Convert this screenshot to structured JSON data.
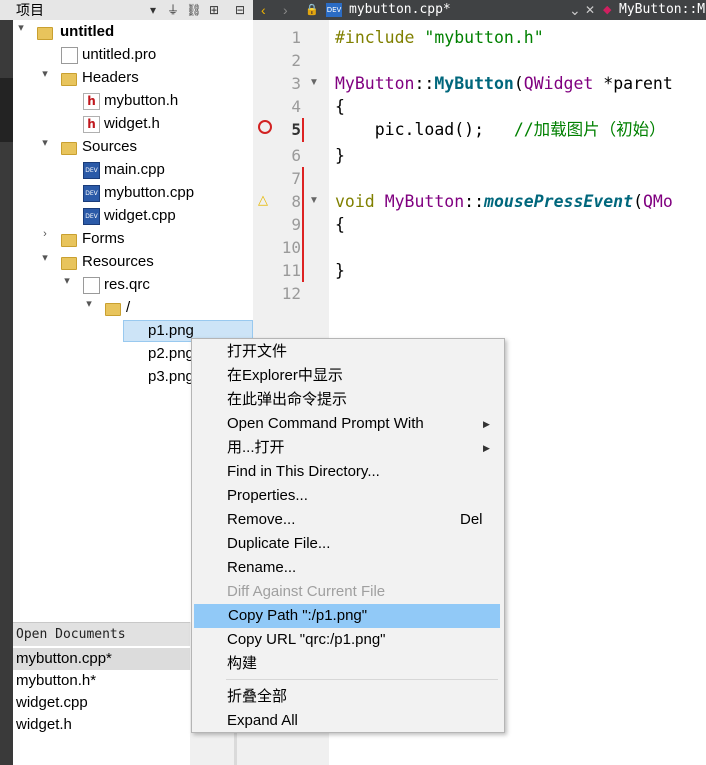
{
  "project_panel": {
    "title": "项目",
    "tree": {
      "project": "untitled",
      "pro_file": "untitled.pro",
      "headers_label": "Headers",
      "headers": [
        "mybutton.h",
        "widget.h"
      ],
      "sources_label": "Sources",
      "sources": [
        "main.cpp",
        "mybutton.cpp",
        "widget.cpp"
      ],
      "forms_label": "Forms",
      "resources_label": "Resources",
      "qrc_file": "res.qrc",
      "prefix": "/",
      "images": [
        "p1.png",
        "p2.png",
        "p3.png"
      ]
    }
  },
  "editor": {
    "file_tab": "mybutton.cpp*",
    "symbol": "MyButton::M",
    "badge": "DEV",
    "line_numbers": [
      "1",
      "2",
      "3",
      "4",
      "5",
      "6",
      "7",
      "8",
      "9",
      "10",
      "11",
      "12"
    ],
    "current_line": "5",
    "lines": {
      "l1_kw": "#include",
      "l1_str": "\"mybutton.h\"",
      "l3_class": "MyButton",
      "l3_sep": "::",
      "l3_fn": "MyButton",
      "l3_paren": "(",
      "l3_type": "QWidget",
      "l3_rest": " *parent",
      "l4": "{",
      "l5_code": "    pic.load();",
      "l5_comment": "   //加载图片（初始）",
      "l6": "}",
      "l8_kw": "void",
      "l8_class": "MyButton",
      "l8_sep": "::",
      "l8_fn": "mousePressEvent",
      "l8_paren": "(",
      "l8_type": "QMo",
      "l9": "{",
      "l11": "}"
    }
  },
  "open_documents": {
    "title": "Open Documents",
    "items": [
      "mybutton.cpp*",
      "mybutton.h*",
      "widget.cpp",
      "widget.h"
    ]
  },
  "context_menu": {
    "items": [
      {
        "label": "打开文件"
      },
      {
        "label": "在Explorer中显示"
      },
      {
        "label": "在此弹出命令提示"
      },
      {
        "label": "Open Command Prompt With",
        "submenu": "▶"
      },
      {
        "label": "用...打开",
        "submenu": "▶"
      },
      {
        "label": "Find in This Directory..."
      },
      {
        "label": "Properties..."
      },
      {
        "label": "Remove...",
        "shortcut": "Del"
      },
      {
        "label": "Duplicate File..."
      },
      {
        "label": "Rename..."
      },
      {
        "label": "Diff Against Current File",
        "disabled": true
      },
      {
        "label": "Copy Path \":/p1.png\"",
        "highlighted": true
      },
      {
        "label": "Copy URL \"qrc:/p1.png\""
      },
      {
        "label": "构建"
      },
      {
        "label": "折叠全部"
      },
      {
        "label": "Expand All"
      }
    ]
  },
  "colors": {
    "editor_header": "#404244",
    "selection": "#cde4f7",
    "menu_highlight": "#91c9f7",
    "breakpoint": "#d22222",
    "warning": "#e6b800"
  }
}
